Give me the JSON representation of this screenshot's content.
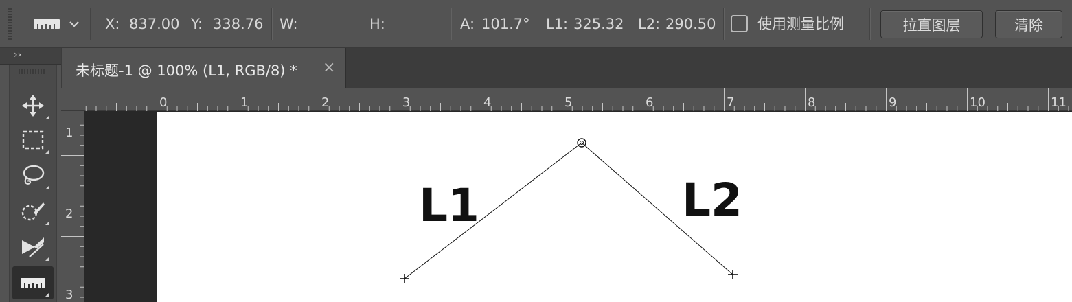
{
  "options_bar": {
    "tool_preset_icon": "ruler-icon",
    "x_label": "X:",
    "x_value": "837.00",
    "y_label": "Y:",
    "y_value": "338.76",
    "w_label": "W:",
    "w_value": "",
    "h_label": "H:",
    "h_value": "",
    "angle_label": "A:",
    "angle_value": "101.7°",
    "l1_label": "L1:",
    "l1_value": "325.32",
    "l2_label": "L2:",
    "l2_value": "290.50",
    "use_scale_label": "使用测量比例",
    "use_scale_checked": false,
    "straighten_button": "拉直图层",
    "clear_button": "清除"
  },
  "toolbar": {
    "collapse_label": "››",
    "tools": [
      {
        "name": "move-tool",
        "icon": "move-icon",
        "active": false
      },
      {
        "name": "marquee-tool",
        "icon": "rect-marquee-icon",
        "active": false
      },
      {
        "name": "lasso-tool",
        "icon": "lasso-icon",
        "active": false
      },
      {
        "name": "quick-selection-tool",
        "icon": "quick-selection-icon",
        "active": false
      },
      {
        "name": "crop-tool",
        "icon": "crop-slice-icon",
        "active": false
      },
      {
        "name": "ruler-tool",
        "icon": "ruler-icon",
        "active": true
      }
    ]
  },
  "document_tab": {
    "title": "未标题-1 @ 100% (L1, RGB/8) *",
    "close_glyph": "×"
  },
  "ruler_h": {
    "labels": [
      "0",
      "1",
      "2",
      "3",
      "4",
      "5",
      "6",
      "7",
      "8",
      "9",
      "10",
      "11"
    ]
  },
  "ruler_v": {
    "labels": [
      "1",
      "2",
      "3"
    ]
  },
  "canvas": {
    "label_left": "L1",
    "label_right": "L2"
  },
  "colors": {
    "panel": "#535353",
    "dark": "#2b2b2b",
    "text": "#d8d8d8",
    "document": "#ffffff"
  }
}
